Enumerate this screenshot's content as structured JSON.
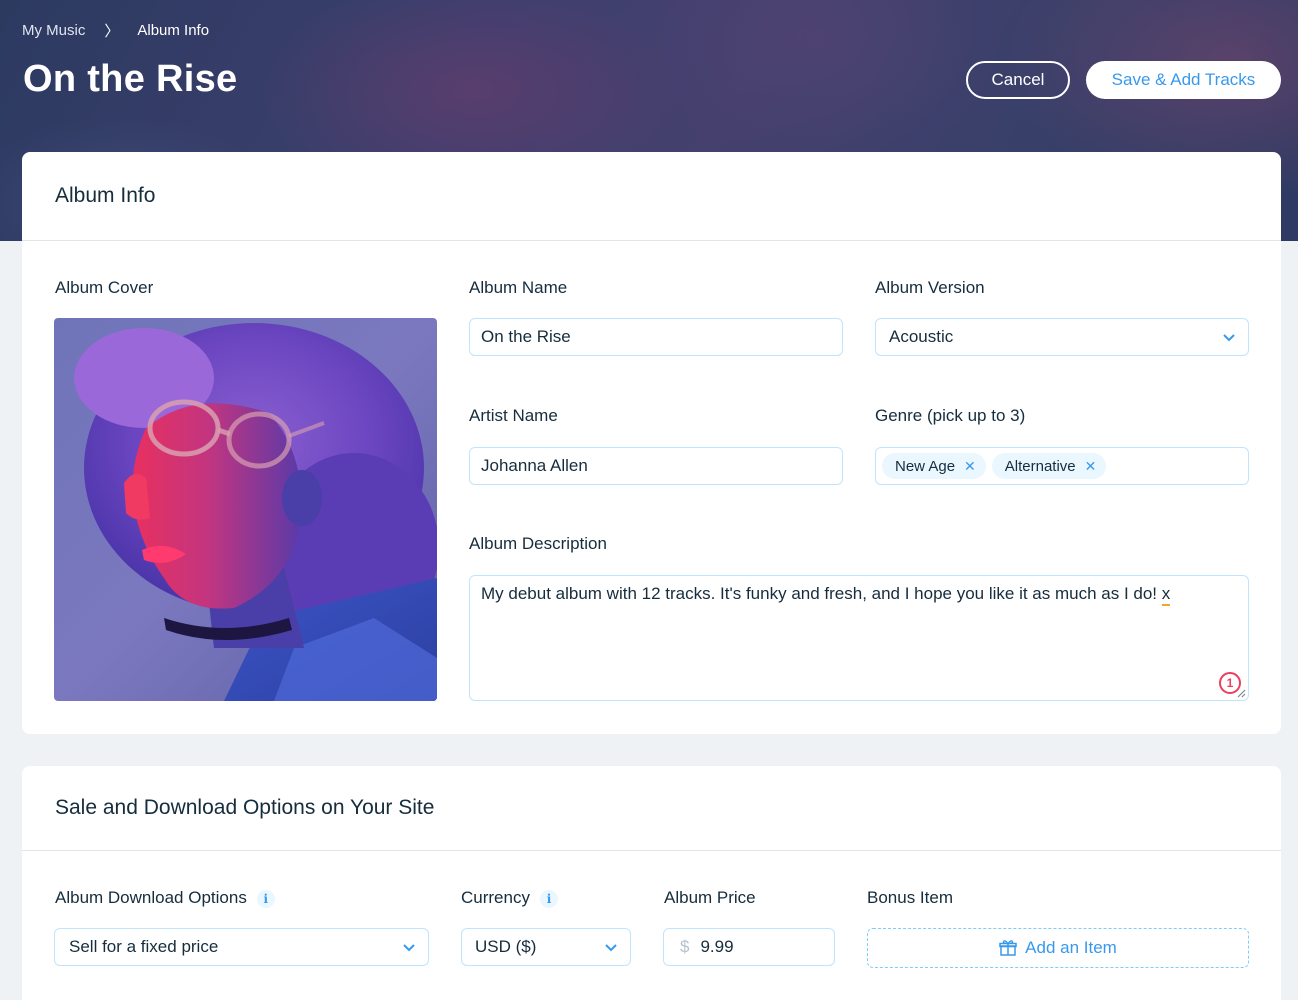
{
  "breadcrumb": {
    "root": "My Music",
    "separator": "〉",
    "current": "Album Info"
  },
  "header": {
    "title": "On the Rise",
    "cancel_label": "Cancel",
    "save_label": "Save & Add Tracks"
  },
  "album_info": {
    "section_title": "Album Info",
    "cover_label": "Album Cover",
    "album_name_label": "Album Name",
    "album_name_value": "On the Rise",
    "album_version_label": "Album Version",
    "album_version_value": "Acoustic",
    "artist_name_label": "Artist Name",
    "artist_name_value": "Johanna Allen",
    "genre_label": "Genre (pick up to 3)",
    "genres": [
      "New Age",
      "Alternative"
    ],
    "description_label": "Album Description",
    "description_text": "My debut album with 12 tracks. It's funky and fresh, and I hope you like it as much as I do! ",
    "description_typo": "x",
    "error_count": "1"
  },
  "sale": {
    "section_title": "Sale and Download Options on Your Site",
    "download_label": "Album Download Options",
    "download_value": "Sell for a fixed price",
    "currency_label": "Currency",
    "currency_value": "USD ($)",
    "price_label": "Album Price",
    "price_symbol": "$",
    "price_value": "9.99",
    "bonus_label": "Bonus Item",
    "bonus_button": "Add an Item"
  },
  "colors": {
    "accent": "#3899ec",
    "error": "#ee3d5e",
    "warning_underline": "#f5a623"
  }
}
